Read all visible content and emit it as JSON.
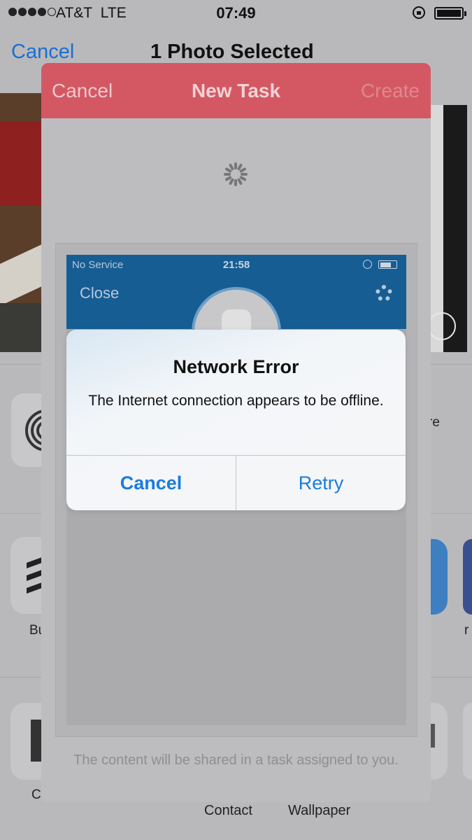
{
  "status_bar": {
    "carrier": "AT&T",
    "network": "LTE",
    "time": "07:49",
    "signal_bars_filled": 4,
    "signal_bars_total": 5,
    "battery_level": 1.0
  },
  "share_sheet": {
    "cancel_label": "Cancel",
    "title": "1 Photo Selected",
    "partial_labels": {
      "airdrop_right_text": "re",
      "app_left_label": "Bu",
      "app_right_label": "r",
      "action_left_label": "C"
    },
    "actions": [
      "Contact",
      "Wallpaper"
    ]
  },
  "task_modal": {
    "cancel_label": "Cancel",
    "title": "New Task",
    "create_label": "Create",
    "footer_text": "The content will be shared in a task assigned to you.",
    "header_color": "#d45863"
  },
  "embedded_screenshot": {
    "status_left": "No Service",
    "status_time": "21:58",
    "close_label": "Close",
    "header_color": "#165d94"
  },
  "alert": {
    "title": "Network Error",
    "message": "The Internet connection appears to be offline.",
    "cancel_label": "Cancel",
    "retry_label": "Retry",
    "button_color": "#1a7ce0"
  }
}
